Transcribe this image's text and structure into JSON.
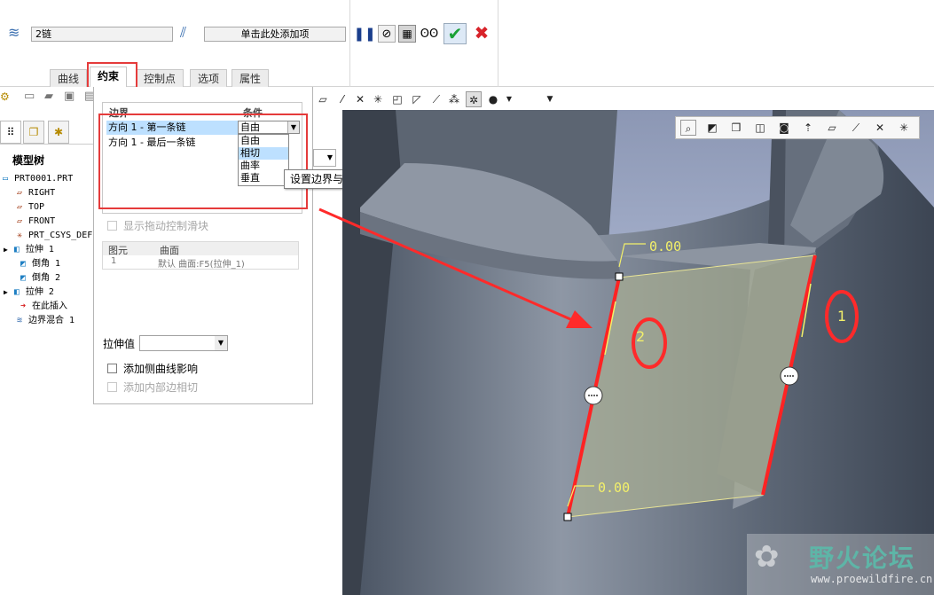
{
  "dashboard": {
    "chain_value": "2链",
    "add_item_placeholder": "单击此处添加项",
    "tabs": [
      {
        "label": "曲线"
      },
      {
        "label": "约束"
      },
      {
        "label": "控制点"
      },
      {
        "label": "选项"
      },
      {
        "label": "属性"
      }
    ]
  },
  "constraints": {
    "header_boundary": "边界",
    "header_condition": "条件",
    "rows": [
      {
        "boundary": "方向 1 - 第一条链",
        "condition": "自由"
      },
      {
        "boundary": "方向 1 - 最后一条链",
        "condition": ""
      }
    ],
    "dropdown_options": [
      "自由",
      "相切",
      "曲率",
      "垂直"
    ],
    "tooltip": "设置边界与曲面参考相切。",
    "show_drag_handles": "显示拖动控制滑块",
    "ref_header_element": "图元",
    "ref_header_surface": "曲面",
    "ref_row_index": "1",
    "ref_row_value": "默认  曲面:F5(拉伸_1)",
    "stretch_label": "拉伸值",
    "add_side_curve": "添加侧曲线影响",
    "add_inner_tangent": "添加内部边相切"
  },
  "tree": {
    "header": "模型树",
    "items": [
      {
        "label": "PRT0001.PRT",
        "icon": "part-icon"
      },
      {
        "label": "RIGHT",
        "icon": "datum-plane-icon"
      },
      {
        "label": "TOP",
        "icon": "datum-plane-icon"
      },
      {
        "label": "FRONT",
        "icon": "datum-plane-icon"
      },
      {
        "label": "PRT_CSYS_DEF",
        "icon": "csys-icon"
      },
      {
        "label": "拉伸 1",
        "icon": "extrude-icon"
      },
      {
        "label": "倒角 1",
        "icon": "chamfer-icon"
      },
      {
        "label": "倒角 2",
        "icon": "chamfer-icon"
      },
      {
        "label": "拉伸 2",
        "icon": "extrude-icon"
      },
      {
        "label": "在此插入",
        "icon": "insert-arrow-icon"
      },
      {
        "label": "边界混合 1",
        "icon": "boundary-blend-icon"
      }
    ]
  },
  "model": {
    "dim_top": "0.00",
    "dim_bottom": "0.00",
    "annotation_1": "1",
    "annotation_2": "2"
  },
  "watermark": {
    "title": "野火论坛",
    "url": "www.proewildfire.cn"
  },
  "colors": {
    "highlight_red": "#e53b3b",
    "dim_yellow": "#f3f06a",
    "selected_row": "#bde0ff"
  }
}
